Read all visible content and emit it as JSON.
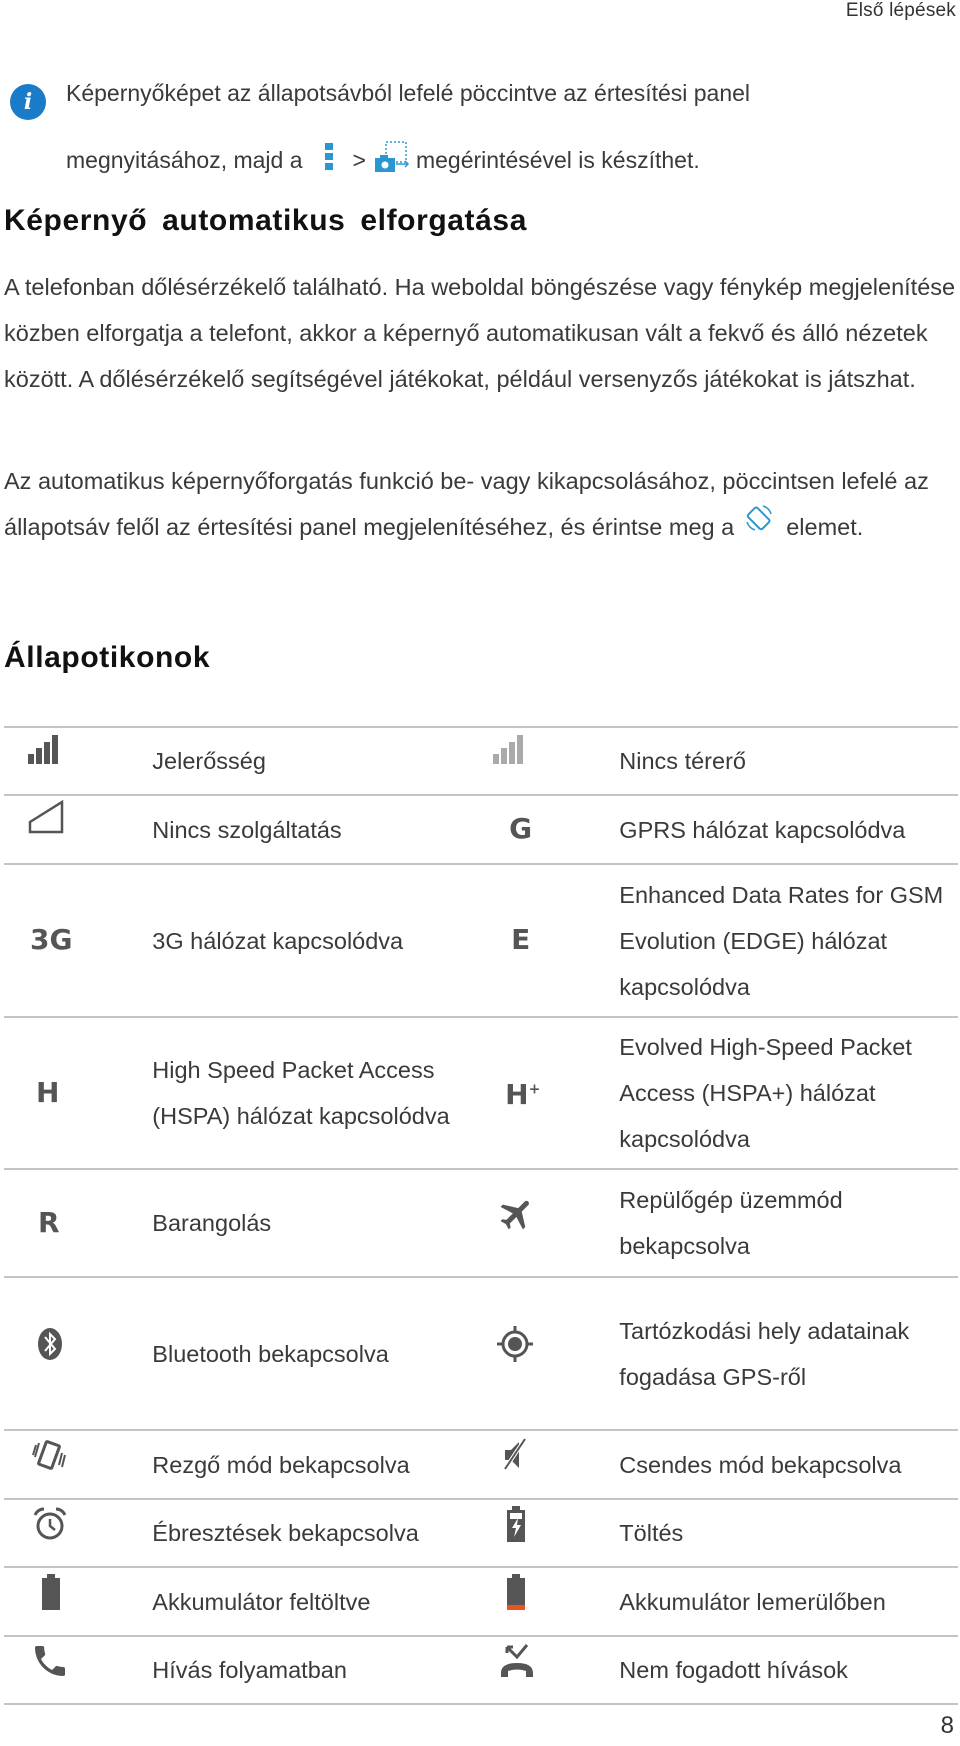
{
  "header": {
    "section": "Első lépések"
  },
  "note": {
    "icon": "info-icon",
    "line1": "Képernyőképet az állapotsávból lefelé pöccintve az értesítési panel",
    "line2_before": "megnyitásához, majd a",
    "separator": ">",
    "line2_after": "megérintésével is készíthet.",
    "menu_icon": "more-menu-icon",
    "screenshot_icon": "screenshot-icon",
    "icon_color": "#2a97d4"
  },
  "rotate_section": {
    "title": "Képernyő automatikus elforgatása",
    "paragraph1": "A telefonban dőlésérzékelő található. Ha weboldal böngészése vagy fénykép megjelenítése közben elforgatja a telefont, akkor a képernyő automatikusan vált a fekvő és álló nézetek között. A dőlésérzékelő segítségével játékokat, például versenyzős játékokat is játszhat.",
    "paragraph2_before": "Az automatikus képernyőforgatás funkció be- vagy kikapcsolásához, pöccintsen lefelé az állapotsáv felől az értesítési panel megjelenítéséhez, és érintse meg a",
    "paragraph2_after": "elemet.",
    "rotate_icon": "auto-rotate-icon"
  },
  "status_icons_section": {
    "title": "Állapotikonok",
    "rows": [
      {
        "left_icon": "signal-strength-icon",
        "left_label": "Jelerősség",
        "right_icon": "no-signal-icon",
        "right_label": "Nincs térerő"
      },
      {
        "left_icon": "no-service-icon",
        "left_label": "Nincs szolgáltatás",
        "right_icon": "gprs-icon",
        "right_glyph": "G",
        "right_label": "GPRS hálózat kapcsolódva"
      },
      {
        "left_icon": "3g-icon",
        "left_glyph": "3G",
        "left_label": "3G hálózat kapcsolódva",
        "right_icon": "edge-icon",
        "right_glyph": "E",
        "right_label": "Enhanced Data Rates for GSM Evolution (EDGE) hálózat kapcsolódva"
      },
      {
        "left_icon": "hspa-icon",
        "left_glyph": "H",
        "left_label": "High Speed Packet Access (HSPA) hálózat kapcsolódva",
        "right_icon": "hspa-plus-icon",
        "right_glyph": "H",
        "right_sup": "+",
        "right_label": "Evolved High-Speed Packet Access (HSPA+) hálózat kapcsolódva"
      },
      {
        "left_icon": "roaming-icon",
        "left_glyph": "R",
        "left_label": "Barangolás",
        "right_icon": "airplane-icon",
        "right_label": "Repülőgép üzemmód bekapcsolva"
      },
      {
        "left_icon": "bluetooth-icon",
        "left_label": "Bluetooth bekapcsolva",
        "right_icon": "gps-icon",
        "right_label": "Tartózkodási hely adatainak fogadása GPS-ről"
      },
      {
        "left_icon": "vibrate-icon",
        "left_label": "Rezgő mód bekapcsolva",
        "right_icon": "silent-icon",
        "right_label": "Csendes mód bekapcsolva"
      },
      {
        "left_icon": "alarm-icon",
        "left_label": "Ébresztések bekapcsolva",
        "right_icon": "charging-icon",
        "right_label": "Töltés"
      },
      {
        "left_icon": "battery-full-icon",
        "left_label": "Akkumulátor feltöltve",
        "right_icon": "battery-low-icon",
        "right_label": "Akkumulátor lemerülőben"
      },
      {
        "left_icon": "call-icon",
        "left_label": "Hívás folyamatban",
        "right_icon": "missed-call-icon",
        "right_label": "Nem fogadott hívások"
      }
    ],
    "icon_color": "#555555",
    "low_battery_color": "#e8541c"
  },
  "footer": {
    "page_number": "8"
  }
}
